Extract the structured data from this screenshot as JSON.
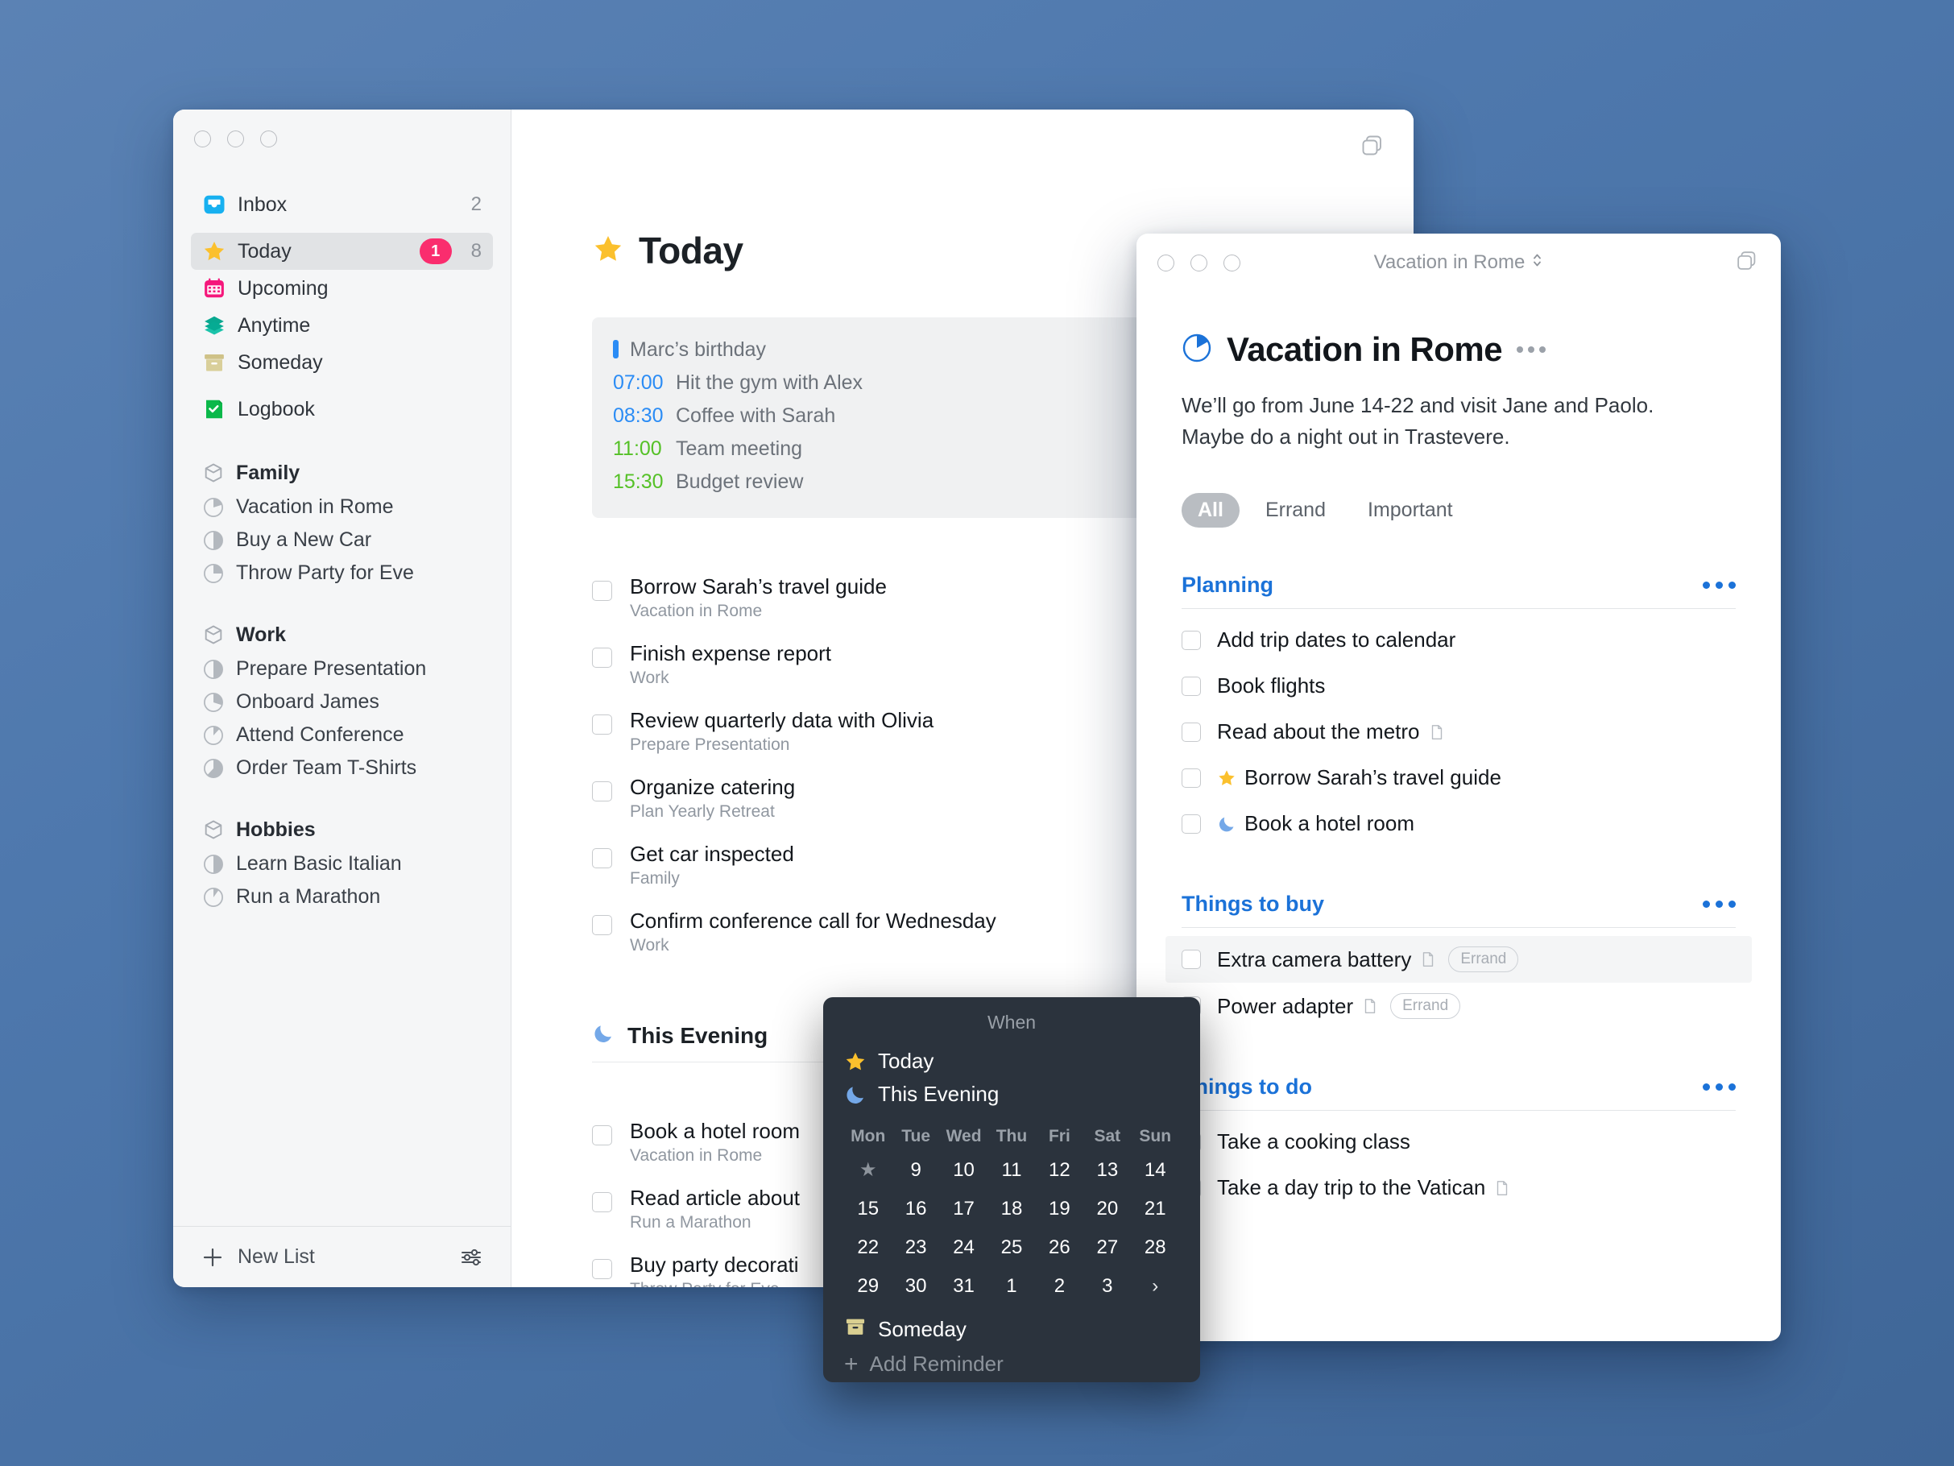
{
  "sidebar": {
    "nav": [
      {
        "label": "Inbox",
        "icon": "inbox-icon",
        "count": "2",
        "badge": "",
        "selected": false
      },
      {
        "label": "Today",
        "icon": "star-icon",
        "count": "8",
        "badge": "1",
        "selected": true
      },
      {
        "label": "Upcoming",
        "icon": "calendar-icon",
        "count": "",
        "badge": "",
        "selected": false
      },
      {
        "label": "Anytime",
        "icon": "layers-icon",
        "count": "",
        "badge": "",
        "selected": false
      },
      {
        "label": "Someday",
        "icon": "archive-box-icon",
        "count": "",
        "badge": "",
        "selected": false
      },
      {
        "label": "Logbook",
        "icon": "logbook-icon",
        "count": "",
        "badge": "",
        "selected": false
      }
    ],
    "groups": [
      {
        "title": "Family",
        "projects": [
          {
            "label": "Vacation in Rome",
            "progress": 20
          },
          {
            "label": "Buy a New Car",
            "progress": 50
          },
          {
            "label": "Throw Party for Eve",
            "progress": 25
          }
        ]
      },
      {
        "title": "Work",
        "projects": [
          {
            "label": "Prepare Presentation",
            "progress": 50
          },
          {
            "label": "Onboard James",
            "progress": 30
          },
          {
            "label": "Attend Conference",
            "progress": 12
          },
          {
            "label": "Order Team T-Shirts",
            "progress": 62
          }
        ]
      },
      {
        "title": "Hobbies",
        "projects": [
          {
            "label": "Learn Basic Italian",
            "progress": 50
          },
          {
            "label": "Run a Marathon",
            "progress": 10
          }
        ]
      }
    ],
    "footer": {
      "new_list_label": "New List",
      "settings_icon": "sliders-icon",
      "add_icon": "plus-icon"
    }
  },
  "today": {
    "title": "Today",
    "title_icon": "star-icon",
    "copy_icon": "copy-window-icon",
    "events": [
      {
        "time": "",
        "bar": true,
        "label": "Marc’s birthday",
        "color": "#2b8cf5"
      },
      {
        "time": "07:00",
        "bar": false,
        "label": "Hit the gym with Alex",
        "color": "#2b8cf5"
      },
      {
        "time": "08:30",
        "bar": false,
        "label": "Coffee with Sarah",
        "color": "#2b8cf5"
      },
      {
        "time": "11:00",
        "bar": false,
        "label": "Team meeting",
        "color": "#55c127"
      },
      {
        "time": "15:30",
        "bar": false,
        "label": "Budget review",
        "color": "#55c127"
      }
    ],
    "tasks": [
      {
        "title": "Borrow Sarah’s travel guide",
        "project": "Vacation in Rome"
      },
      {
        "title": "Finish expense report",
        "project": "Work"
      },
      {
        "title": "Review quarterly data with Olivia",
        "project": "Prepare Presentation"
      },
      {
        "title": "Organize catering",
        "project": "Plan Yearly Retreat"
      },
      {
        "title": "Get car inspected",
        "project": "Family"
      },
      {
        "title": "Confirm conference call for Wednesday",
        "project": "Work"
      }
    ],
    "evening": {
      "title": "This Evening",
      "icon": "moon-icon",
      "tasks": [
        {
          "title": "Book a hotel room",
          "project": "Vacation in Rome"
        },
        {
          "title": "Read article about",
          "project": "Run a Marathon"
        },
        {
          "title": "Buy party decorati",
          "project": "Throw Party for Eve"
        }
      ]
    }
  },
  "project_window": {
    "titlebar": "Vacation in Rome",
    "titlebar_chevron_icon": "chevron-updown-icon",
    "copy_icon": "copy-window-icon",
    "heading": "Vacation in Rome",
    "heading_icon": "project-progress-icon",
    "more_icon": "more-dots-icon",
    "notes": "We’ll go from June 14-22 and visit Jane and Paolo. Maybe do a night out in Trastevere.",
    "filters": [
      {
        "label": "All",
        "active": true
      },
      {
        "label": "Errand",
        "active": false
      },
      {
        "label": "Important",
        "active": false
      }
    ],
    "sections": [
      {
        "title": "Planning",
        "items": [
          {
            "label": "Add trip dates to calendar",
            "prefix_icon": "",
            "note_icon": false,
            "tag": "",
            "highlight": false
          },
          {
            "label": "Book flights",
            "prefix_icon": "",
            "note_icon": false,
            "tag": "",
            "highlight": false
          },
          {
            "label": "Read about the metro",
            "prefix_icon": "",
            "note_icon": true,
            "tag": "",
            "highlight": false
          },
          {
            "label": "Borrow Sarah’s travel guide",
            "prefix_icon": "star-icon",
            "note_icon": false,
            "tag": "",
            "highlight": false
          },
          {
            "label": "Book a hotel room",
            "prefix_icon": "moon-icon",
            "note_icon": false,
            "tag": "",
            "highlight": false
          }
        ]
      },
      {
        "title": "Things to buy",
        "items": [
          {
            "label": "Extra camera battery",
            "prefix_icon": "",
            "note_icon": true,
            "tag": "Errand",
            "highlight": true
          },
          {
            "label": "Power adapter",
            "prefix_icon": "",
            "note_icon": true,
            "tag": "Errand",
            "highlight": false
          }
        ]
      },
      {
        "title": "Things to do",
        "items": [
          {
            "label": "Take a cooking class",
            "prefix_icon": "",
            "note_icon": false,
            "tag": "",
            "highlight": false
          },
          {
            "label": "Take a day trip to the Vatican",
            "prefix_icon": "",
            "note_icon": true,
            "tag": "",
            "highlight": false
          }
        ]
      }
    ]
  },
  "when_popup": {
    "title": "When",
    "options": [
      {
        "label": "Today",
        "icon": "star-icon"
      },
      {
        "label": "This Evening",
        "icon": "moon-icon"
      }
    ],
    "weekdays": [
      "Mon",
      "Tue",
      "Wed",
      "Thu",
      "Fri",
      "Sat",
      "Sun"
    ],
    "weeks": [
      [
        "★",
        "9",
        "10",
        "11",
        "12",
        "13",
        "14"
      ],
      [
        "15",
        "16",
        "17",
        "18",
        "19",
        "20",
        "21"
      ],
      [
        "22",
        "23",
        "24",
        "25",
        "26",
        "27",
        "28"
      ],
      [
        "29",
        "30",
        "31",
        "1",
        "2",
        "3",
        "›"
      ]
    ],
    "someday": {
      "label": "Someday",
      "icon": "archive-box-icon"
    },
    "add_reminder": {
      "label": "Add Reminder",
      "icon": "plus-icon"
    }
  },
  "colors": {
    "accent_blue": "#1b72d8",
    "badge_pink": "#fa2d6e",
    "star_yellow": "#fbc02d",
    "event_blue": "#2b8cf5",
    "event_green": "#55c127",
    "popup_bg": "#2b333d"
  }
}
